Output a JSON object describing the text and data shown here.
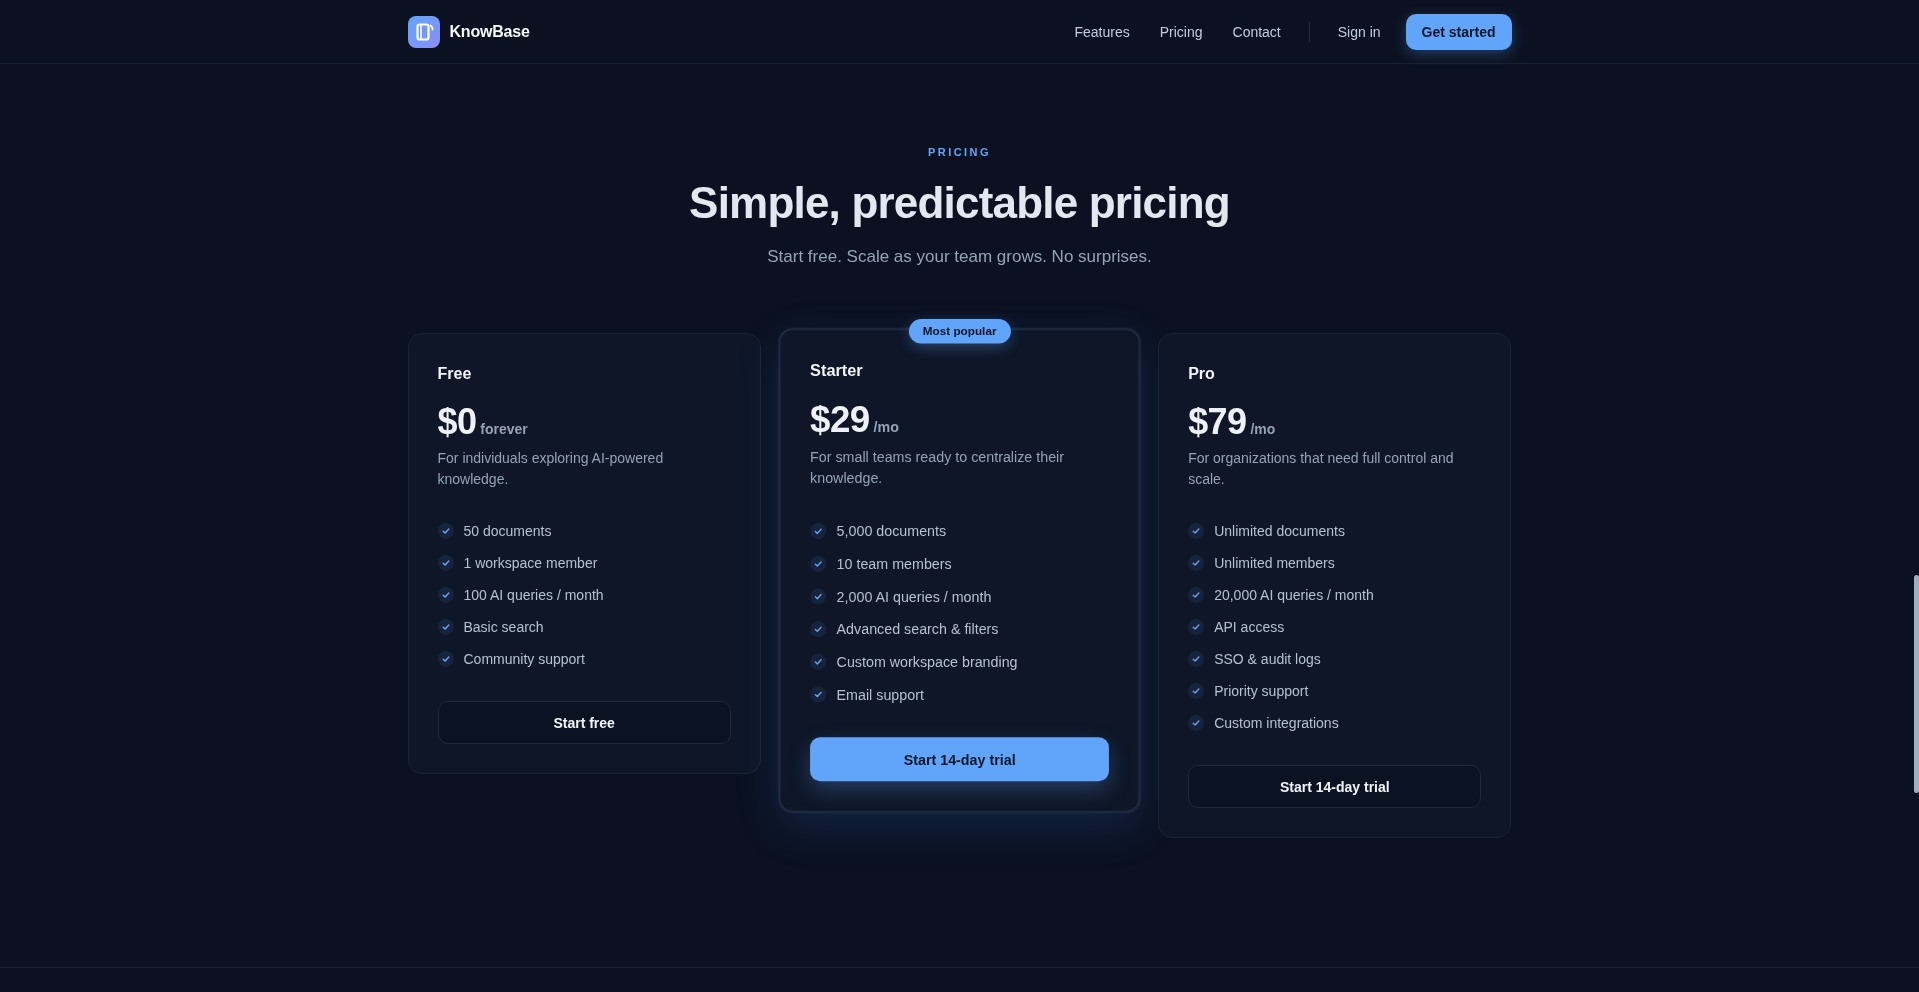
{
  "nav": {
    "brand": "KnowBase",
    "links": [
      "Features",
      "Pricing",
      "Contact"
    ],
    "sign_in": "Sign in",
    "cta": "Get started"
  },
  "header": {
    "eyebrow": "PRICING",
    "title": "Simple, predictable pricing",
    "subtitle": "Start free. Scale as your team grows. No surprises."
  },
  "plans": [
    {
      "name": "Free",
      "price": "$0",
      "period": "forever",
      "description": "For individuals exploring AI-powered knowledge.",
      "features": [
        "50 documents",
        "1 workspace member",
        "100 AI queries / month",
        "Basic search",
        "Community support"
      ],
      "button": "Start free",
      "featured": false
    },
    {
      "name": "Starter",
      "badge": "Most popular",
      "price": "$29",
      "period": "/mo",
      "description": "For small teams ready to centralize their knowledge.",
      "features": [
        "5,000 documents",
        "10 team members",
        "2,000 AI queries / month",
        "Advanced search & filters",
        "Custom workspace branding",
        "Email support"
      ],
      "button": "Start 14-day trial",
      "featured": true
    },
    {
      "name": "Pro",
      "price": "$79",
      "period": "/mo",
      "description": "For organizations that need full control and scale.",
      "features": [
        "Unlimited documents",
        "Unlimited members",
        "20,000 AI queries / month",
        "API access",
        "SSO & audit logs",
        "Priority support",
        "Custom integrations"
      ],
      "button": "Start 14-day trial",
      "featured": false
    }
  ]
}
